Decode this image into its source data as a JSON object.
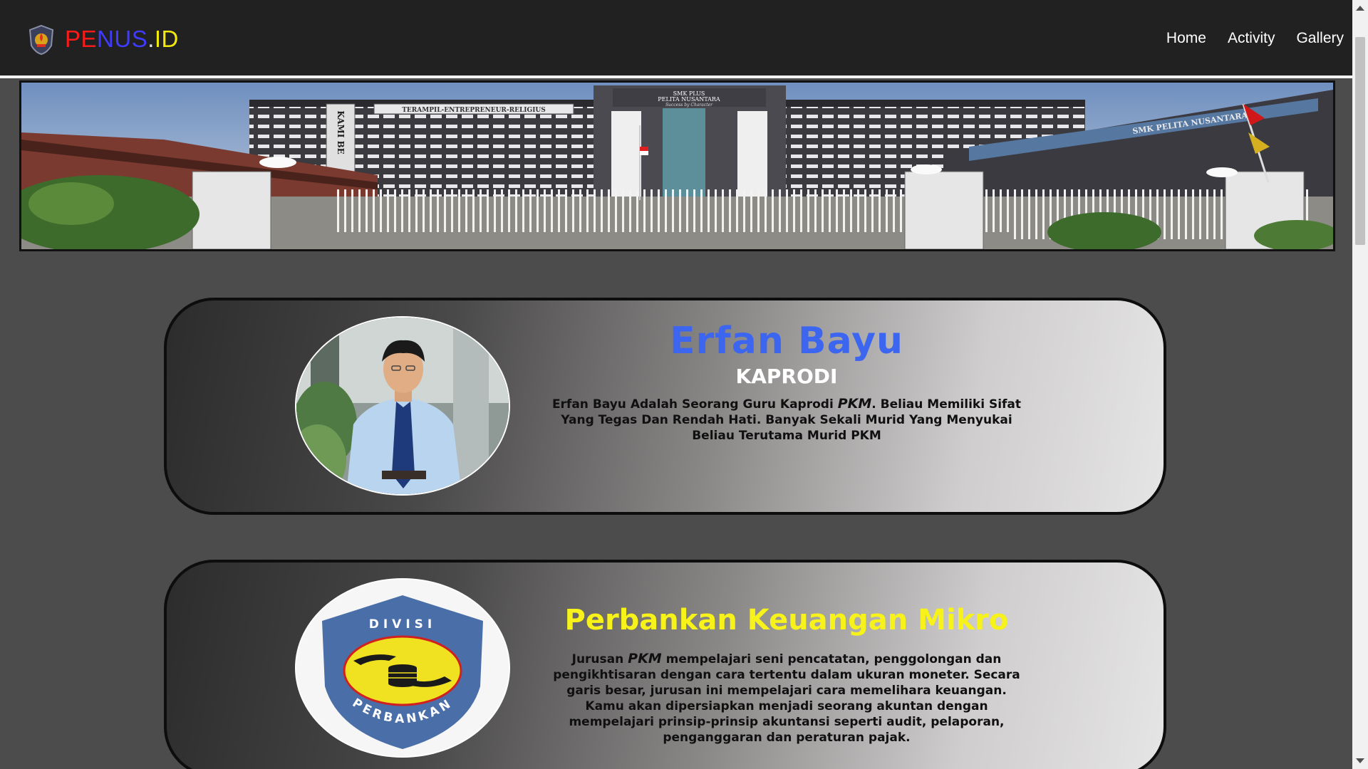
{
  "navbar": {
    "brand": {
      "pe": "PE",
      "nus": "NUS",
      "dot": ".",
      "id": "ID"
    },
    "links": [
      {
        "label": "Home"
      },
      {
        "label": "Activity"
      },
      {
        "label": "Gallery"
      }
    ]
  },
  "hero": {
    "signage": {
      "school_line1": "SMK PLUS",
      "school_line2": "PELITA NUSANTARA",
      "school_line3": "Success by Character",
      "banner": "TERAMPIL-ENTREPRENEUR-RELIGIUS",
      "pillar": "KAMI BE",
      "side_sign": "SMK PELITA NUSANTARA"
    }
  },
  "cards": [
    {
      "name": "Erfan Bayu",
      "role": "KAPRODI",
      "desc_before": "Erfan Bayu Adalah Seorang Guru Kaprodi ",
      "desc_em": "PKM",
      "desc_after": ". Beliau Memiliki Sifat Yang Tegas Dan Rendah Hati. Banyak Sekali Murid Yang Menyukai Beliau Terutama Murid PKM"
    },
    {
      "title": "Perbankan Keuangan Mikro",
      "emblem_top": "DIVISI",
      "emblem_bottom": "PERBANKAN",
      "desc_before": "Jurusan ",
      "desc_em": "PKM",
      "desc_after": " mempelajari seni pencatatan, penggolongan dan pengikhtisaran dengan cara tertentu dalam ukuran moneter. Secara garis besar, jurusan ini mempelajari cara memelihara keuangan. Kamu akan dipersiapkan menjadi seorang akuntan dengan mempelajari prinsip-prinsip akuntansi seperti audit, pelaporan, penganggaran dan peraturan pajak."
    }
  ],
  "colors": {
    "navbar_bg": "#212121",
    "page_bg": "#4d4c4c",
    "name_blue": "#3d66f0",
    "title_yellow": "#f6f21a",
    "brand_red": "#ff1a1a",
    "brand_blue": "#3f3bff",
    "brand_yellow": "#f2e90f"
  }
}
